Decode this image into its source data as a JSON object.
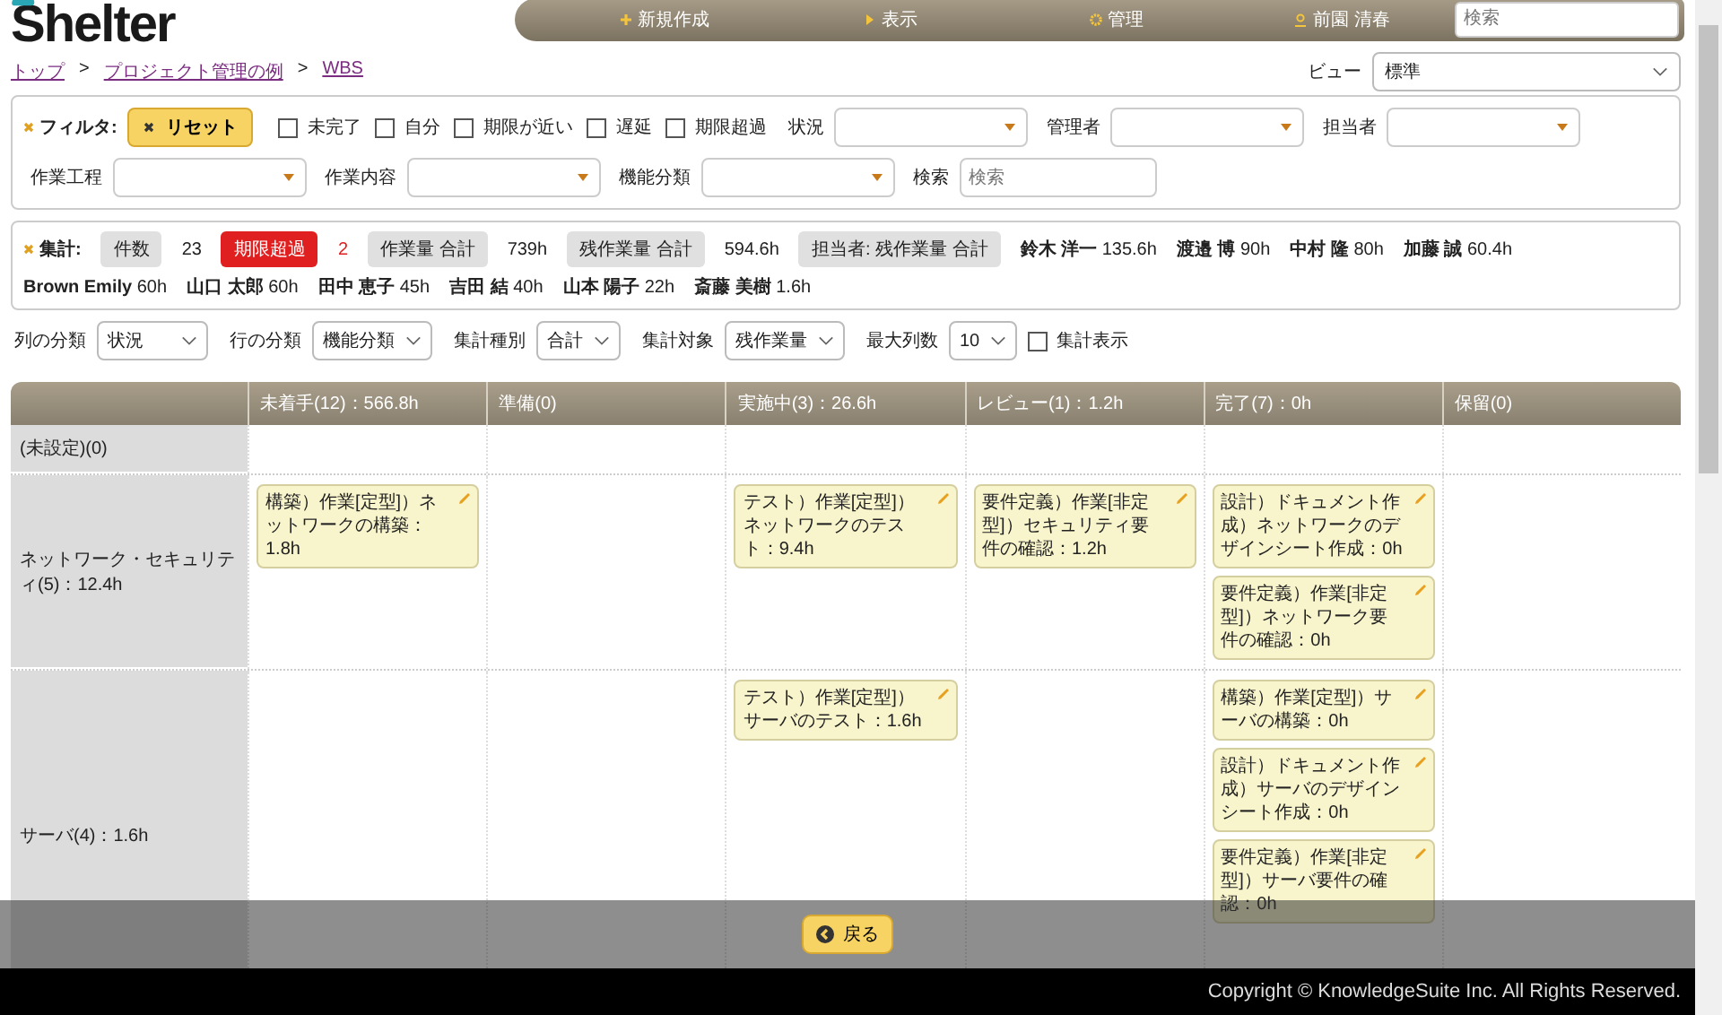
{
  "logo": {
    "text": "Shelter"
  },
  "nav": {
    "items": [
      {
        "kind": "plus",
        "label": "新規作成"
      },
      {
        "kind": "arrow",
        "label": "表示"
      },
      {
        "kind": "gear",
        "label": "管理"
      },
      {
        "kind": "user",
        "label": "前園 清春"
      }
    ],
    "search": {
      "placeholder": "検索"
    }
  },
  "breadcrumb": {
    "separator": ">",
    "items": [
      "トップ",
      "プロジェクト管理の例",
      "WBS"
    ]
  },
  "view": {
    "label": "ビュー",
    "value": "標準"
  },
  "filter": {
    "title": "フィルタ:",
    "reset": "リセット",
    "checkboxes": [
      {
        "label": "未完了",
        "checked": false
      },
      {
        "label": "自分",
        "checked": false
      },
      {
        "label": "期限が近い",
        "checked": false
      },
      {
        "label": "遅延",
        "checked": false
      },
      {
        "label": "期限超過",
        "checked": false
      }
    ],
    "dropdowns": [
      {
        "label": "状況"
      },
      {
        "label": "管理者"
      },
      {
        "label": "担当者"
      },
      {
        "label": "作業工程"
      },
      {
        "label": "作業内容"
      },
      {
        "label": "機能分類"
      }
    ],
    "search": {
      "label": "検索",
      "placeholder": "検索"
    }
  },
  "summary": {
    "title": "集計:",
    "stats": [
      {
        "label": "件数",
        "value": "23",
        "alert": false
      },
      {
        "label": "期限超過",
        "value": "2",
        "alert": true
      },
      {
        "label": "作業量 合計",
        "value": "739h",
        "alert": false
      },
      {
        "label": "残作業量 合計",
        "value": "594.6h",
        "alert": false
      }
    ],
    "assignee_label": "担当者: 残作業量 合計",
    "people": [
      {
        "name": "鈴木 洋一",
        "hours": "135.6h"
      },
      {
        "name": "渡邉 博",
        "hours": "90h"
      },
      {
        "name": "中村 隆",
        "hours": "80h"
      },
      {
        "name": "加藤 誠",
        "hours": "60.4h"
      },
      {
        "name": "Brown Emily",
        "hours": "60h"
      },
      {
        "name": "山口 太郎",
        "hours": "60h"
      },
      {
        "name": "田中 恵子",
        "hours": "45h"
      },
      {
        "name": "吉田 結",
        "hours": "40h"
      },
      {
        "name": "山本 陽子",
        "hours": "22h"
      },
      {
        "name": "斎藤 美樹",
        "hours": "1.6h"
      }
    ]
  },
  "controls": {
    "selects": [
      {
        "label": "列の分類",
        "value": "状況"
      },
      {
        "label": "行の分類",
        "value": "機能分類"
      },
      {
        "label": "集計種別",
        "value": "合計"
      },
      {
        "label": "集計対象",
        "value": "残作業量"
      },
      {
        "label": "最大列数",
        "value": "10"
      }
    ],
    "checkbox": {
      "label": "集計表示",
      "checked": false
    }
  },
  "board": {
    "columns": [
      "未着手(12)：566.8h",
      "準備(0)",
      "実施中(3)：26.6h",
      "レビュー(1)：1.2h",
      "完了(7)：0h",
      "保留(0)"
    ],
    "rows": [
      {
        "label": "(未設定)(0)",
        "cells": [
          [],
          [],
          [],
          [],
          [],
          []
        ]
      },
      {
        "label": "ネットワーク・セキュリティ(5)：12.4h",
        "cells": [
          [
            "構築）作業[定型]）ネットワークの構築：1.8h"
          ],
          [],
          [
            "テスト）作業[定型]）ネットワークのテスト：9.4h"
          ],
          [
            "要件定義）作業[非定型]）セキュリティ要件の確認：1.2h"
          ],
          [
            "設計）ドキュメント作成）ネットワークのデザインシート作成：0h",
            "要件定義）作業[非定型]）ネットワーク要件の確認：0h"
          ],
          []
        ]
      },
      {
        "label": "サーバ(4)：1.6h",
        "cells": [
          [],
          [],
          [
            "テスト）作業[定型]）サーバのテスト：1.6h"
          ],
          [],
          [
            "構築）作業[定型]）サーバの構築：0h",
            "設計）ドキュメント作成）サーバのデザインシート作成：0h",
            "要件定義）作業[非定型]）サーバ要件の確認：0h"
          ],
          []
        ]
      }
    ]
  },
  "back_button": "戻る",
  "footer": "Copyright © KnowledgeSuite Inc. All Rights Reserved."
}
